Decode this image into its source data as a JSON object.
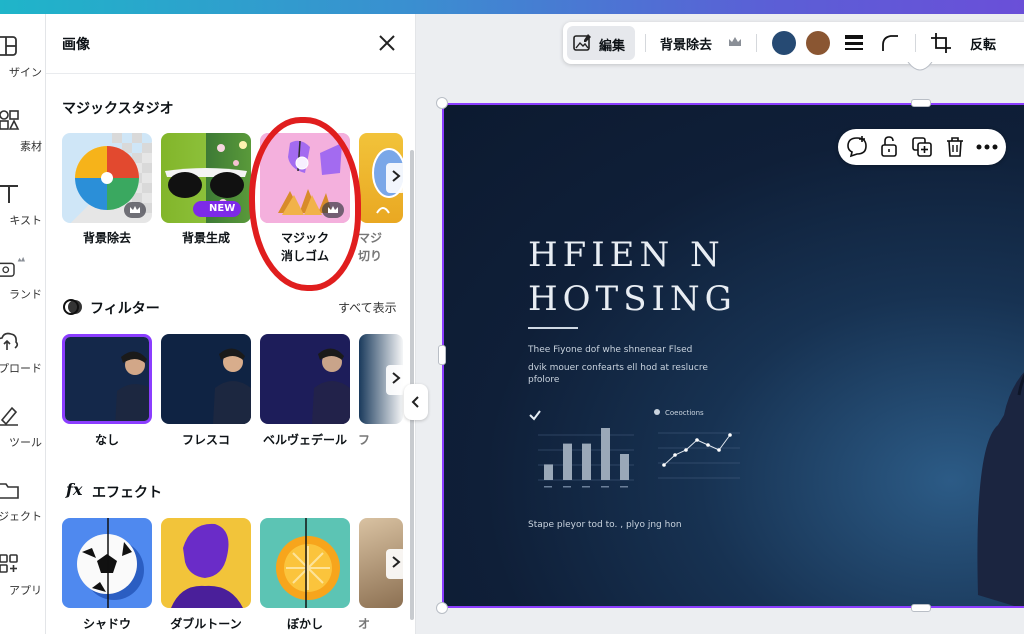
{
  "rail": {
    "items": [
      {
        "label": "ザイン",
        "icon": "layout-icon"
      },
      {
        "label": "素材",
        "icon": "elements-icon"
      },
      {
        "label": "キスト",
        "icon": "text-icon"
      },
      {
        "label": "ランド",
        "icon": "brand-icon"
      },
      {
        "label": "プロード",
        "icon": "upload-icon"
      },
      {
        "label": "ツール",
        "icon": "draw-icon"
      },
      {
        "label": "ロジェクト",
        "icon": "folder-icon"
      },
      {
        "label": "アプリ",
        "icon": "apps-icon"
      }
    ]
  },
  "panel": {
    "title": "画像",
    "magic_studio": {
      "title": "マジックスタジオ",
      "tiles": [
        {
          "label": "背景除去"
        },
        {
          "label": "背景生成",
          "badge": "NEW"
        },
        {
          "label": "マジック\n消しゴム"
        },
        {
          "label": "マジ\n切り"
        }
      ]
    },
    "filter": {
      "title": "フィルター",
      "see_all": "すべて表示",
      "tiles": [
        {
          "label": "なし"
        },
        {
          "label": "フレスコ"
        },
        {
          "label": "ベルヴェデール"
        },
        {
          "label": "フ"
        }
      ]
    },
    "effect": {
      "title": "エフェクト",
      "tiles": [
        {
          "label": "シャドウ"
        },
        {
          "label": "ダブルトーン"
        },
        {
          "label": "ぼかし"
        },
        {
          "label": "オ"
        }
      ]
    }
  },
  "toolbar": {
    "edit": "編集",
    "bg_remove": "背景除去",
    "flip": "反転",
    "colors": [
      "#264a73",
      "#8a5632"
    ]
  },
  "slide": {
    "title_line1": "HFIEN N",
    "title_line2": "HOTSING",
    "body1": "Thee Fiyone dof whe shnenear Flsed",
    "body2": "dvik mouer confearts ell hod at reslucre",
    "body3": "pfolore",
    "legend2": "Coeoctions",
    "footer": "Stape pleyor tod to. , plyo jng hon",
    "bar_chart": {
      "values": [
        3,
        7,
        7,
        10,
        5
      ]
    },
    "line_chart": {
      "values": [
        2,
        4,
        5,
        7,
        6,
        5,
        8
      ]
    }
  }
}
